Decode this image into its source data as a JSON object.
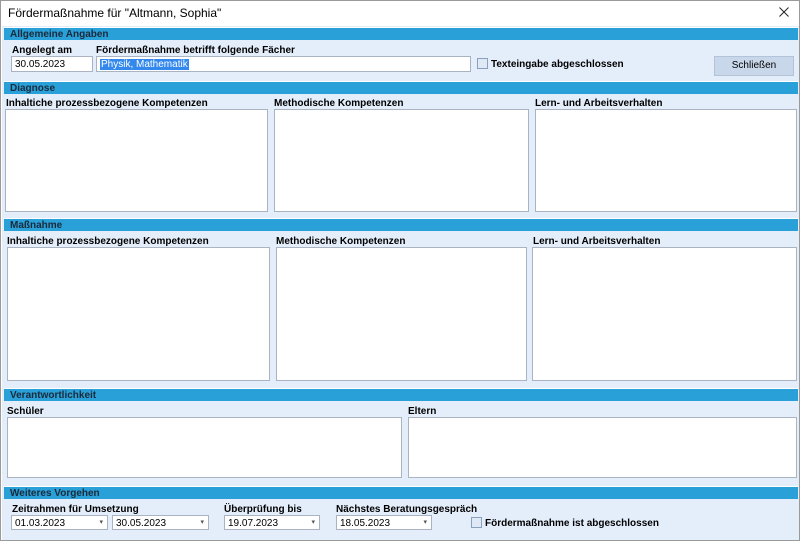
{
  "window": {
    "title": "Fördermaßnahme für \"Altmann, Sophia\""
  },
  "icons": {
    "close": "close-icon",
    "dropdown": "chevron-down-icon"
  },
  "allgemein": {
    "header": "Allgemeine Angaben",
    "angelegt_label": "Angelegt am",
    "angelegt_value": "30.05.2023",
    "faecher_label": "Fördermaßnahme betrifft folgende Fächer",
    "faecher_value": "Physik, Mathematik",
    "texteingabe_label": "Texteingabe abgeschlossen",
    "texteingabe_checked": false,
    "close_button": "Schließen"
  },
  "diagnose": {
    "header": "Diagnose",
    "col1": "Inhaltiche prozessbezogene Kompetenzen",
    "col2": "Methodische Kompetenzen",
    "col3": "Lern- und Arbeitsverhalten"
  },
  "massnahme": {
    "header": "Maßnahme",
    "col1": "Inhaltiche prozessbezogene Kompetenzen",
    "col2": "Methodische Kompetenzen",
    "col3": "Lern- und Arbeitsverhalten"
  },
  "verantwortlichkeit": {
    "header": "Verantwortlichkeit",
    "schueler": "Schüler",
    "eltern": "Eltern"
  },
  "weiteres": {
    "header": "Weiteres Vorgehen",
    "zeitrahmen_label": "Zeitrahmen für Umsetzung",
    "zeitrahmen_from": "01.03.2023",
    "zeitrahmen_to": "30.05.2023",
    "ueberpruefung_label": "Überprüfung bis",
    "ueberpruefung_value": "19.07.2023",
    "beratung_label": "Nächstes Beratungsgespräch",
    "beratung_value": "18.05.2023",
    "abgeschlossen_label": "Fördermaßnahme ist abgeschlossen",
    "abgeschlossen_checked": false
  },
  "colors": {
    "section_header": "#2aa0d8",
    "panel_background": "#e4eefb",
    "selection": "#3388ee"
  }
}
